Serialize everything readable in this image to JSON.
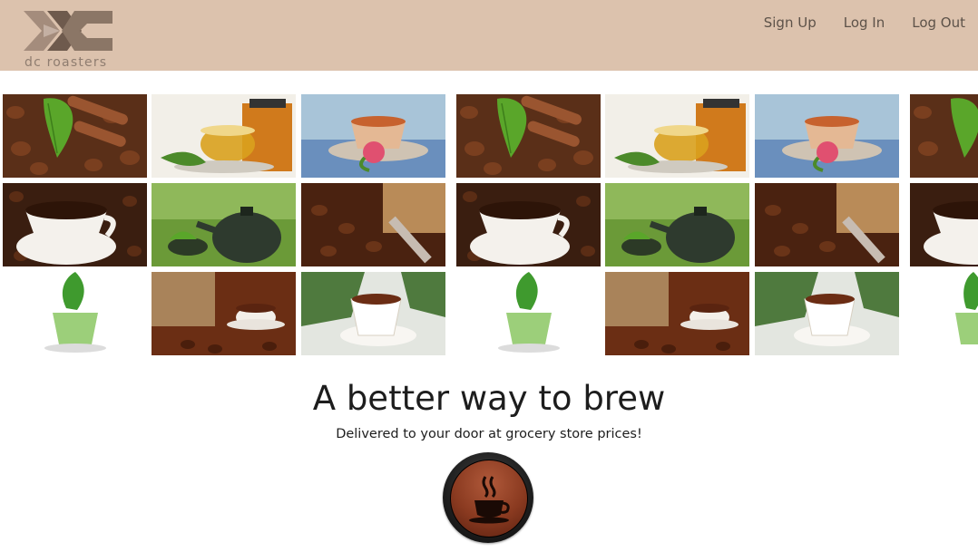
{
  "header": {
    "logo_text": "dc roasters",
    "nav": [
      {
        "label": "Sign Up"
      },
      {
        "label": "Log In"
      },
      {
        "label": "Log Out"
      }
    ]
  },
  "gallery": {
    "tiles": [
      "cinnamon-beans-leaf",
      "tea-glass-pot",
      "teacup-rose",
      "coffee-cup-beans",
      "green-teapot",
      "coffee-sack-scoop",
      "green-tea-leaf-cup",
      "coffee-sack-cup",
      "white-coffee-cup"
    ]
  },
  "hero": {
    "title": "A better way to brew",
    "subtitle": "Delivered to your door at grocery store prices!",
    "button_icon": "coffee-cup-icon"
  },
  "colors": {
    "header_bg": "#dcc2ad",
    "nav_text": "#5d5249",
    "button_face": "#8a3a20"
  }
}
